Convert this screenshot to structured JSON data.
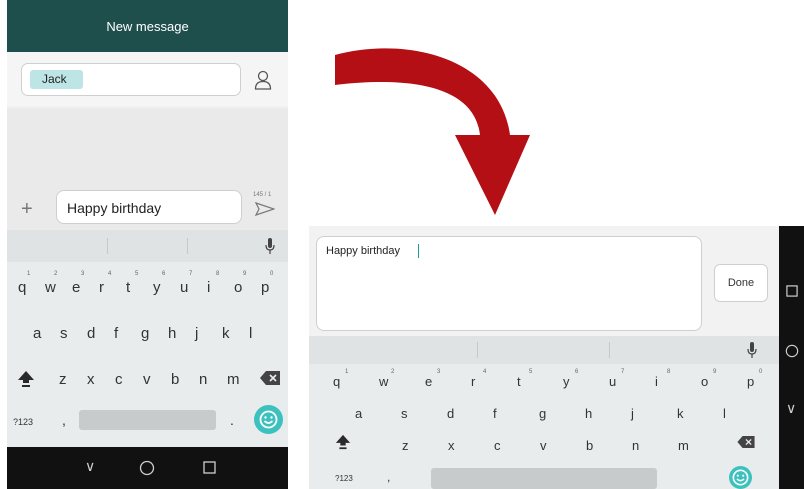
{
  "left_phone": {
    "title": "New message",
    "recipient_chip": "Jack",
    "compose_text": "Happy birthday",
    "char_counter": "145 / 1",
    "keyboard": {
      "row1": [
        "q",
        "w",
        "e",
        "r",
        "t",
        "y",
        "u",
        "i",
        "o",
        "p"
      ],
      "row1_hints": [
        "1",
        "2",
        "3",
        "4",
        "5",
        "6",
        "7",
        "8",
        "9",
        "0"
      ],
      "row2": [
        "a",
        "s",
        "d",
        "f",
        "g",
        "h",
        "j",
        "k",
        "l"
      ],
      "row3": [
        "z",
        "x",
        "c",
        "v",
        "b",
        "n",
        "m"
      ],
      "symbols_key": "?123",
      "comma": ",",
      "period": "."
    }
  },
  "right_phone": {
    "compose_text": "Happy birthday",
    "done_label": "Done",
    "keyboard": {
      "row1": [
        "q",
        "w",
        "e",
        "r",
        "t",
        "y",
        "u",
        "i",
        "o",
        "p"
      ],
      "row1_hints": [
        "1",
        "2",
        "3",
        "4",
        "5",
        "6",
        "7",
        "8",
        "9",
        "0"
      ],
      "row2": [
        "a",
        "s",
        "d",
        "f",
        "g",
        "h",
        "j",
        "k",
        "l"
      ],
      "row3": [
        "z",
        "x",
        "c",
        "v",
        "b",
        "n",
        "m"
      ],
      "symbols_key": "?123",
      "comma": ","
    }
  },
  "colors": {
    "title_bar": "#1f4f4d",
    "chip": "#bde5e6",
    "accent": "#3cc1bf",
    "arrow": "#b40f14"
  },
  "icons": [
    "contact-icon",
    "plus-icon",
    "send-icon",
    "mic-icon",
    "shift-icon",
    "backspace-icon",
    "emoji-icon",
    "back-icon",
    "home-icon",
    "recents-icon",
    "arrow-icon"
  ]
}
